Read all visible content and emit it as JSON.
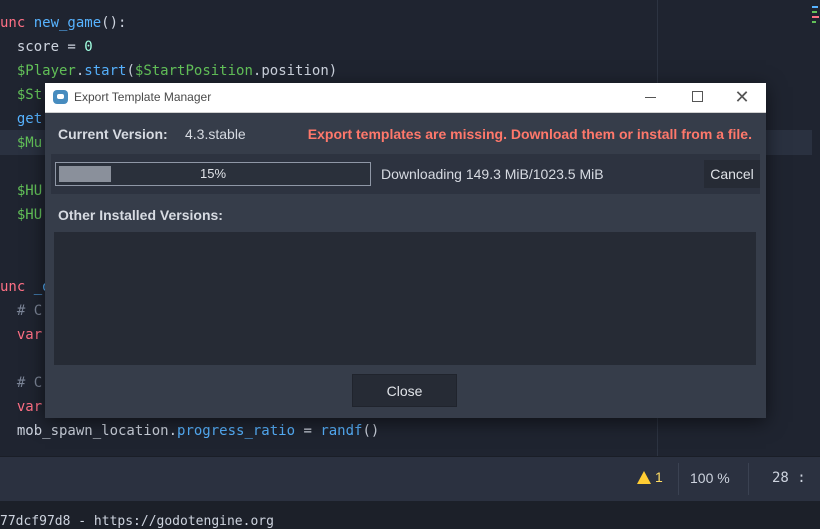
{
  "editor": {
    "lines": [
      {
        "parts": [
          {
            "c": "kw",
            "t": "unc "
          },
          {
            "c": "fn",
            "t": "new_game"
          },
          {
            "c": "var",
            "t": "():"
          }
        ]
      },
      {
        "parts": [
          {
            "c": "var",
            "t": "  score = "
          },
          {
            "c": "num",
            "t": "0"
          }
        ]
      },
      {
        "parts": [
          {
            "c": "node",
            "t": "  $Player"
          },
          {
            "c": "var",
            "t": "."
          },
          {
            "c": "fn",
            "t": "start"
          },
          {
            "c": "var",
            "t": "("
          },
          {
            "c": "node",
            "t": "$StartPosition"
          },
          {
            "c": "var",
            "t": ".position)"
          }
        ]
      },
      {
        "parts": [
          {
            "c": "node",
            "t": "  $St"
          }
        ]
      },
      {
        "parts": [
          {
            "c": "fn",
            "t": "  get"
          }
        ]
      },
      {
        "parts": [
          {
            "c": "node",
            "t": "  $Mu"
          }
        ]
      },
      {
        "parts": []
      },
      {
        "parts": [
          {
            "c": "node",
            "t": "  $HU"
          }
        ]
      },
      {
        "parts": [
          {
            "c": "node",
            "t": "  $HU"
          }
        ]
      },
      {
        "parts": []
      },
      {
        "parts": []
      },
      {
        "parts": [
          {
            "c": "kw",
            "t": "unc "
          },
          {
            "c": "fn",
            "t": "_o"
          }
        ]
      },
      {
        "parts": [
          {
            "c": "cmt",
            "t": "  # C"
          }
        ]
      },
      {
        "parts": [
          {
            "c": "kw",
            "t": "  var"
          }
        ]
      },
      {
        "parts": []
      },
      {
        "parts": [
          {
            "c": "cmt",
            "t": "  # C"
          }
        ]
      },
      {
        "parts": [
          {
            "c": "kw",
            "t": "  var"
          }
        ]
      },
      {
        "parts": [
          {
            "c": "var",
            "t": "  mob_spawn_location."
          },
          {
            "c": "fn",
            "t": "progress_ratio"
          },
          {
            "c": "var",
            "t": " = "
          },
          {
            "c": "fn",
            "t": "randf"
          },
          {
            "c": "var",
            "t": "()"
          }
        ]
      }
    ]
  },
  "statusbar": {
    "warnings": "1",
    "zoom": "100 %",
    "line_col": "28 :"
  },
  "output": {
    "text": "77dcf97d8 - https://godotengine.org"
  },
  "dialog": {
    "title": "Export Template Manager",
    "current_version_label": "Current Version:",
    "current_version_value": "4.3.stable",
    "missing_message": "Export templates are missing. Download them or install from a file.",
    "progress_percent": 15,
    "progress_text": "15%",
    "download_status": "Downloading 149.3 MiB/1023.5 MiB",
    "cancel_label": "Cancel",
    "other_versions_label": "Other Installed Versions:",
    "close_label": "Close"
  },
  "colors": {
    "missing_message": "#ff786b",
    "warning": "#ffcc33"
  }
}
